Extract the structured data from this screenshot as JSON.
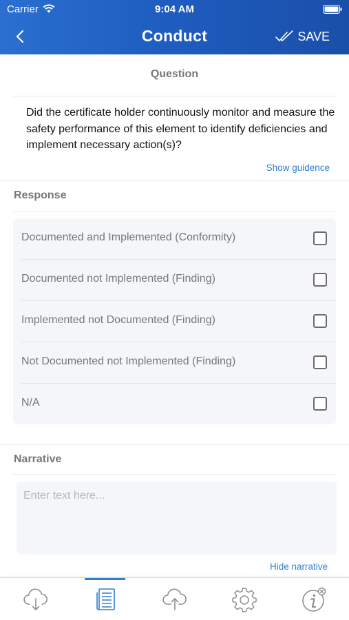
{
  "status_bar": {
    "carrier": "Carrier",
    "time": "9:04 AM"
  },
  "header": {
    "title": "Conduct",
    "save_label": "SAVE"
  },
  "question": {
    "heading": "Question",
    "text": "Did the certificate holder continuously monitor and measure the safety performance of this element to identify deficiencies and implement necessary action(s)?",
    "guidance_link": "Show guidence"
  },
  "response": {
    "heading": "Response",
    "options": [
      {
        "label": "Documented and Implemented (Conformity)",
        "checked": false
      },
      {
        "label": "Documented not Implemented (Finding)",
        "checked": false
      },
      {
        "label": "Implemented not Documented (Finding)",
        "checked": false
      },
      {
        "label": "Not Documented not Implemented (Finding)",
        "checked": false
      },
      {
        "label": "N/A",
        "checked": false
      }
    ]
  },
  "narrative": {
    "heading": "Narrative",
    "placeholder": "Enter text here...",
    "value": "",
    "hide_link": "Hide narrative"
  },
  "tabbar": {
    "tabs": [
      {
        "icon": "cloud-download-icon",
        "active": false
      },
      {
        "icon": "document-list-icon",
        "active": true
      },
      {
        "icon": "cloud-upload-icon",
        "active": false
      },
      {
        "icon": "gear-icon",
        "active": false
      },
      {
        "icon": "info-icon",
        "active": false
      }
    ]
  },
  "colors": {
    "header_gradient_start": "#2a6fd1",
    "header_gradient_end": "#1a4fa8",
    "link": "#2f7fd1",
    "panel": "#f4f6f9",
    "muted_text": "#777777"
  }
}
